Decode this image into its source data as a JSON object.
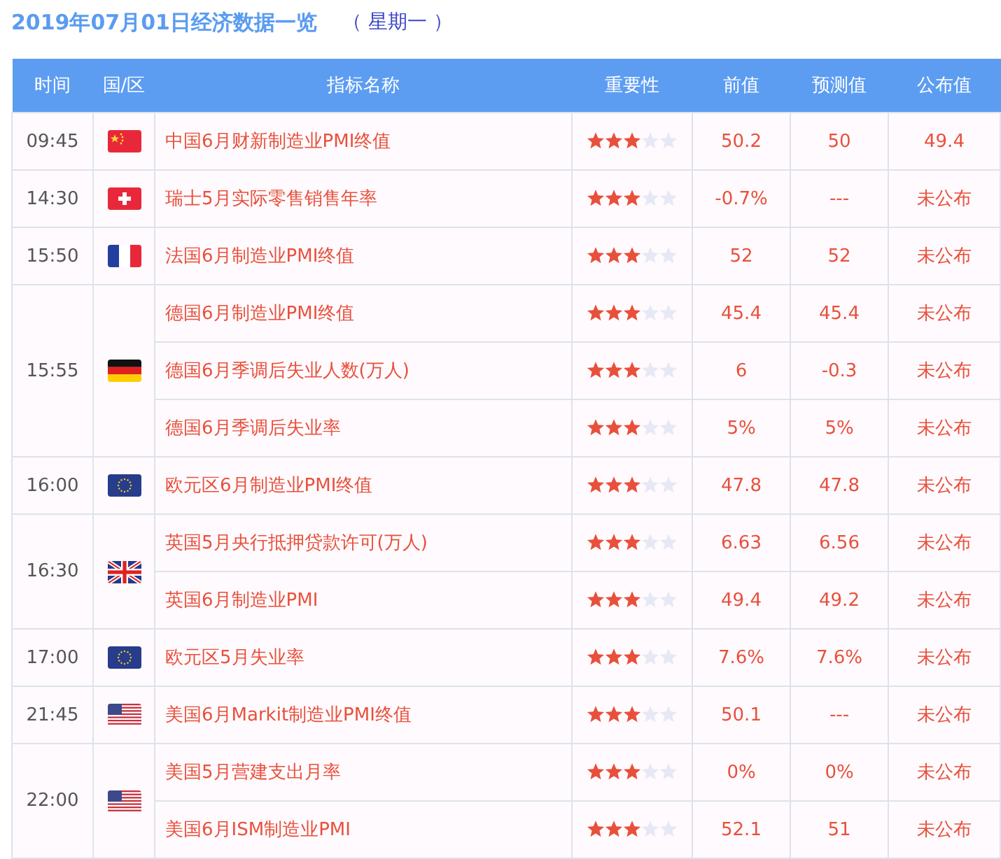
{
  "title": {
    "date": "2019年07月01日经济数据一览",
    "weekday": "（ 星期一 ）"
  },
  "table": {
    "columns": [
      "时间",
      "国/区",
      "指标名称",
      "重要性",
      "前值",
      "预测值",
      "公布值"
    ],
    "groups": [
      {
        "time": "09:45",
        "kind": "cn",
        "events": [
          {
            "name": "中国6月财新制造业PMI终值",
            "stars": 3,
            "previous": "50.2",
            "forecast": "50",
            "actual": "49.4"
          }
        ]
      },
      {
        "time": "14:30",
        "kind": "ch",
        "events": [
          {
            "name": "瑞士5月实际零售销售年率",
            "stars": 3,
            "previous": "-0.7%",
            "forecast": "---",
            "actual": "未公布"
          }
        ]
      },
      {
        "time": "15:50",
        "kind": "fr",
        "events": [
          {
            "name": "法国6月制造业PMI终值",
            "stars": 3,
            "previous": "52",
            "forecast": "52",
            "actual": "未公布"
          }
        ]
      },
      {
        "time": "15:55",
        "kind": "de",
        "events": [
          {
            "name": "德国6月制造业PMI终值",
            "stars": 3,
            "previous": "45.4",
            "forecast": "45.4",
            "actual": "未公布"
          },
          {
            "name": "德国6月季调后失业人数(万人)",
            "stars": 3,
            "previous": "6",
            "forecast": "-0.3",
            "actual": "未公布"
          },
          {
            "name": "德国6月季调后失业率",
            "stars": 3,
            "previous": "5%",
            "forecast": "5%",
            "actual": "未公布"
          }
        ]
      },
      {
        "time": "16:00",
        "kind": "eu",
        "events": [
          {
            "name": "欧元区6月制造业PMI终值",
            "stars": 3,
            "previous": "47.8",
            "forecast": "47.8",
            "actual": "未公布"
          }
        ]
      },
      {
        "time": "16:30",
        "kind": "gb",
        "events": [
          {
            "name": "英国5月央行抵押贷款许可(万人)",
            "stars": 3,
            "previous": "6.63",
            "forecast": "6.56",
            "actual": "未公布"
          },
          {
            "name": "英国6月制造业PMI",
            "stars": 3,
            "previous": "49.4",
            "forecast": "49.2",
            "actual": "未公布"
          }
        ]
      },
      {
        "time": "17:00",
        "kind": "eu",
        "events": [
          {
            "name": "欧元区5月失业率",
            "stars": 3,
            "previous": "7.6%",
            "forecast": "7.6%",
            "actual": "未公布"
          }
        ]
      },
      {
        "time": "21:45",
        "kind": "us",
        "events": [
          {
            "name": "美国6月Markit制造业PMI终值",
            "stars": 3,
            "previous": "50.1",
            "forecast": "---",
            "actual": "未公布"
          }
        ]
      },
      {
        "time": "22:00",
        "kind": "us",
        "events": [
          {
            "name": "美国5月营建支出月率",
            "stars": 3,
            "previous": "0%",
            "forecast": "0%",
            "actual": "未公布"
          },
          {
            "name": "美国6月ISM制造业PMI",
            "stars": 3,
            "previous": "52.1",
            "forecast": "51",
            "actual": "未公布"
          }
        ]
      }
    ]
  }
}
